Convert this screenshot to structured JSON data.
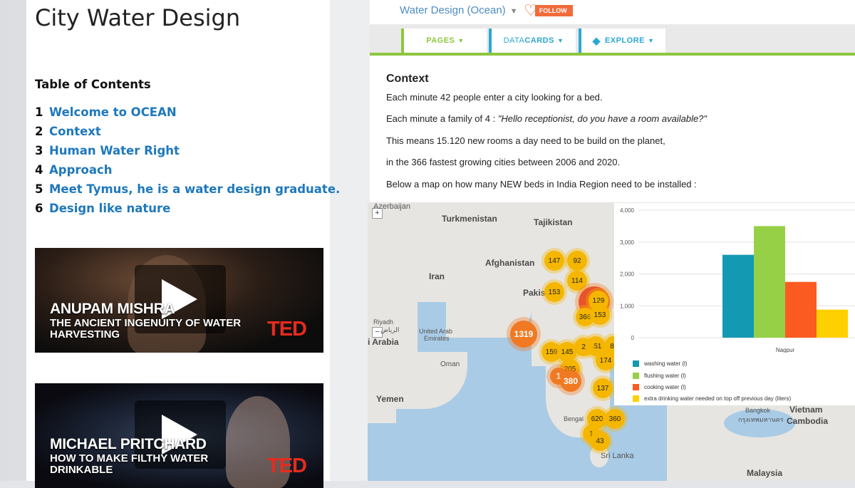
{
  "doc": {
    "title": "City Water Design",
    "toc_heading": "Table of Contents",
    "toc": [
      {
        "num": "1",
        "label": "Welcome to OCEAN"
      },
      {
        "num": "2",
        "label": "Context"
      },
      {
        "num": "3",
        "label": "Human Water Right"
      },
      {
        "num": "4",
        "label": "Approach"
      },
      {
        "num": "5",
        "label": "Meet Tymus, he is a water design graduate."
      },
      {
        "num": "6",
        "label": "Design like nature"
      }
    ],
    "videos": [
      {
        "name": "ANUPAM MISHRA",
        "subtitle": "THE ANCIENT INGENUITY OF WATER HARVESTING",
        "brand": "TED"
      },
      {
        "name": "MICHAEL PRITCHARD",
        "subtitle": "HOW TO MAKE FILTHY WATER DRINKABLE",
        "brand": "TED"
      }
    ]
  },
  "topbar": {
    "title": "Water Design (Ocean)",
    "follow_label": "FOLLOW"
  },
  "tabs": [
    {
      "label": "PAGES",
      "color": "#8dc63f"
    },
    {
      "label_prefix": "DATA",
      "label_suffix": "CARDS",
      "color": "#2aa8d6"
    },
    {
      "label": "EXPLORE",
      "color": "#2aa8d6"
    }
  ],
  "content": {
    "heading": "Context",
    "p1": "Each minute 42 people enter a city looking for a bed.",
    "p2_prefix": "Each minute a family of 4 : ",
    "p2_quote": "\"Hello receptionist, do you have a room available?\"",
    "p3": "This means 15.120 new rooms a day need to be build on the planet,",
    "p4": "in the 366 fastest growing cities between 2006 and 2020.",
    "p5": "Below a map on how many NEW beds in India Region need to be installed :"
  },
  "map": {
    "zoom_in": "+",
    "zoom_out": "−",
    "labels": [
      "Azerbaijan",
      "Turkmenistan",
      "Tajikistan",
      "Afghanistan",
      "Iran",
      "Pakis",
      "Riyadh",
      "الرياض",
      "i Arabia",
      "United Arab",
      "Emirates",
      "Oman",
      "Yemen",
      "Sri Lanka",
      "Bengal",
      "Vietnam",
      "Bangkok",
      "กรุงเทพมหานคร",
      "Cambodia",
      "Malaysia"
    ],
    "clusters": [
      "147",
      "92",
      "114",
      "153",
      "129",
      "2",
      "366",
      "153",
      "1319",
      "151",
      "8",
      "2",
      "159",
      "145",
      "174",
      "205",
      "1",
      "380",
      "137",
      "620",
      "360",
      "1",
      "43"
    ]
  },
  "chart_data": {
    "type": "bar",
    "categories": [
      "Nagpur"
    ],
    "series": [
      {
        "name": "washing water (l)",
        "values": [
          2600
        ],
        "color": "#1499b2"
      },
      {
        "name": "flushing water (l)",
        "values": [
          3500
        ],
        "color": "#96d046"
      },
      {
        "name": "cooking water (l)",
        "values": [
          1750
        ],
        "color": "#fb5b20"
      },
      {
        "name": "extra drinking water needed on top off previous day (liters)",
        "values": [
          880
        ],
        "color": "#ffd000"
      }
    ],
    "yticks": [
      "0",
      "1,000",
      "2,000",
      "3,000",
      "4,000"
    ],
    "ylim": [
      0,
      4000
    ],
    "legend": "bottom"
  }
}
